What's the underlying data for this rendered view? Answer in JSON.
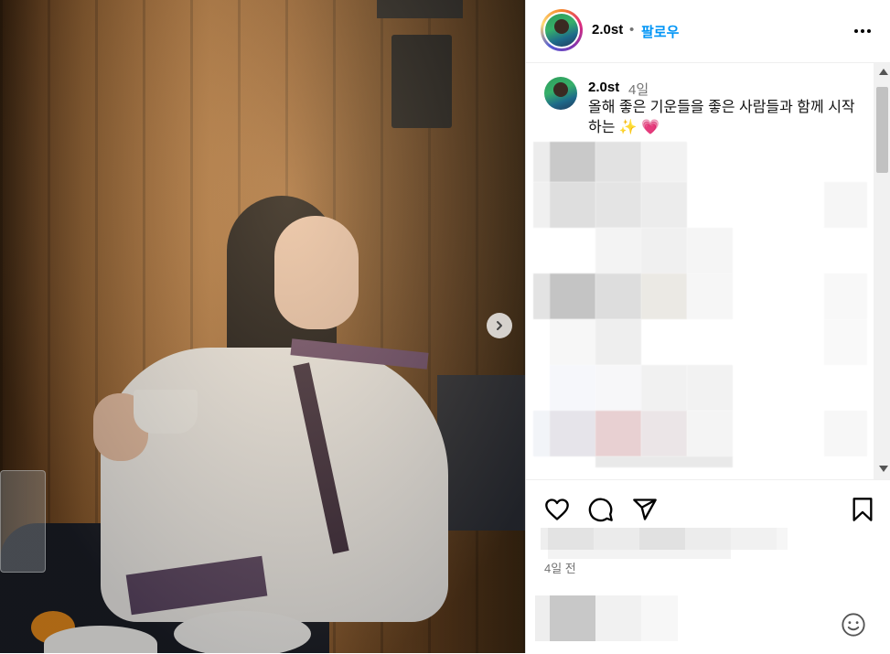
{
  "post": {
    "username": "2.0st",
    "separator": "•",
    "follow_label": "팔로우",
    "caption_username": "2.0st",
    "caption_time": "4일",
    "caption_text": "올해 좋은 기운들을 좋은 사람들과 함께 시작하는 ✨ 💗",
    "time_ago": "4일 전"
  },
  "icons": {
    "more": "more-options-icon",
    "next": "chevron-right-icon",
    "like": "heart-icon",
    "comment": "comment-icon",
    "share": "send-icon",
    "save": "bookmark-icon",
    "emoji": "emoji-icon"
  },
  "colors": {
    "accent": "#0095f6",
    "muted": "#737373",
    "border": "#dbdbdb"
  }
}
